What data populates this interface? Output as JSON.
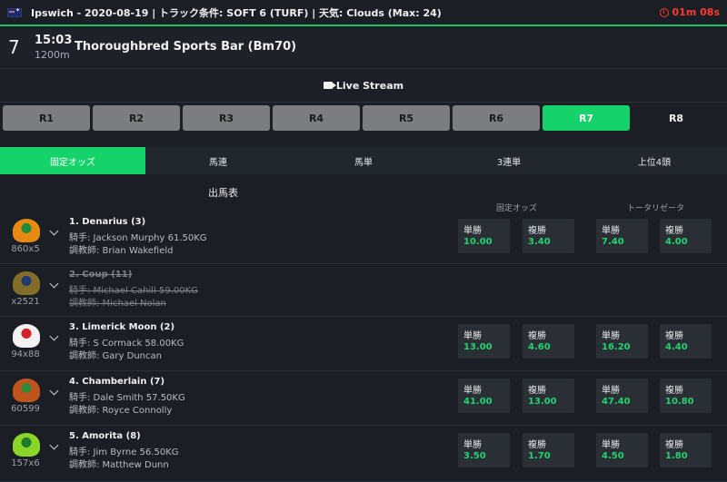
{
  "topbar": {
    "info": "Ipswich - 2020-08-19 | トラック条件: SOFT 6 (TURF)  |  天気:  Clouds (Max: 24)",
    "timer": "01m 08s"
  },
  "race": {
    "number": "7",
    "time": "15:03",
    "distance": "1200m",
    "name": "Thoroughbred Sports Bar (Bm70)"
  },
  "live_stream_label": "Live Stream",
  "race_tabs": [
    "R1",
    "R2",
    "R3",
    "R4",
    "R5",
    "R6",
    "R7",
    "R8"
  ],
  "active_race_tab": "R7",
  "bet_tabs": [
    "固定オッズ",
    "馬連",
    "馬単",
    "3連単",
    "上位4頭"
  ],
  "card_title": "出馬表",
  "column_headers": {
    "fixed": "固定オッズ",
    "tote": "トータリゼータ"
  },
  "odds_labels": {
    "win": "単勝",
    "place": "複勝"
  },
  "runners": [
    {
      "name": "1. Denarius (3)",
      "jockey": "騎手: Jackson Murphy 61.50KG",
      "trainer": "調教師: Brian Wakefield",
      "form": "860x5",
      "scratched": false,
      "fixed_win": "10.00",
      "fixed_place": "3.40",
      "tote_win": "7.40",
      "tote_place": "4.00",
      "silk_color": "#e88a12",
      "silk_accent": "#1e8a3a"
    },
    {
      "name": "2. Coup (11)",
      "jockey": "騎手: Michael Cahill 59.00KG",
      "trainer": "調教師: Michael Nolan",
      "form": "x2521",
      "scratched": true,
      "silk_color": "#c7a32c",
      "silk_accent": "#2a4aa8"
    },
    {
      "name": "3. Limerick Moon (2)",
      "jockey": "騎手: S Cormack 58.00KG",
      "trainer": "調教師: Gary Duncan",
      "form": "94x88",
      "scratched": false,
      "fixed_win": "13.00",
      "fixed_place": "4.60",
      "tote_win": "16.20",
      "tote_place": "4.40",
      "silk_color": "#f2f2f2",
      "silk_accent": "#d61f26"
    },
    {
      "name": "4. Chamberlain (7)",
      "jockey": "騎手: Dale Smith 57.50KG",
      "trainer": "調教師: Royce Connolly",
      "form": "60599",
      "scratched": false,
      "fixed_win": "41.00",
      "fixed_place": "13.00",
      "tote_win": "47.40",
      "tote_place": "10.80",
      "silk_color": "#c0541e",
      "silk_accent": "#2f8a3a"
    },
    {
      "name": "5. Amorita (8)",
      "jockey": "騎手: Jim Byrne 56.50KG",
      "trainer": "調教師: Matthew Dunn",
      "form": "157x6",
      "scratched": false,
      "fixed_win": "3.50",
      "fixed_place": "1.70",
      "tote_win": "4.50",
      "tote_place": "1.80",
      "silk_color": "#8bd42a",
      "silk_accent": "#1f7a2a"
    }
  ]
}
